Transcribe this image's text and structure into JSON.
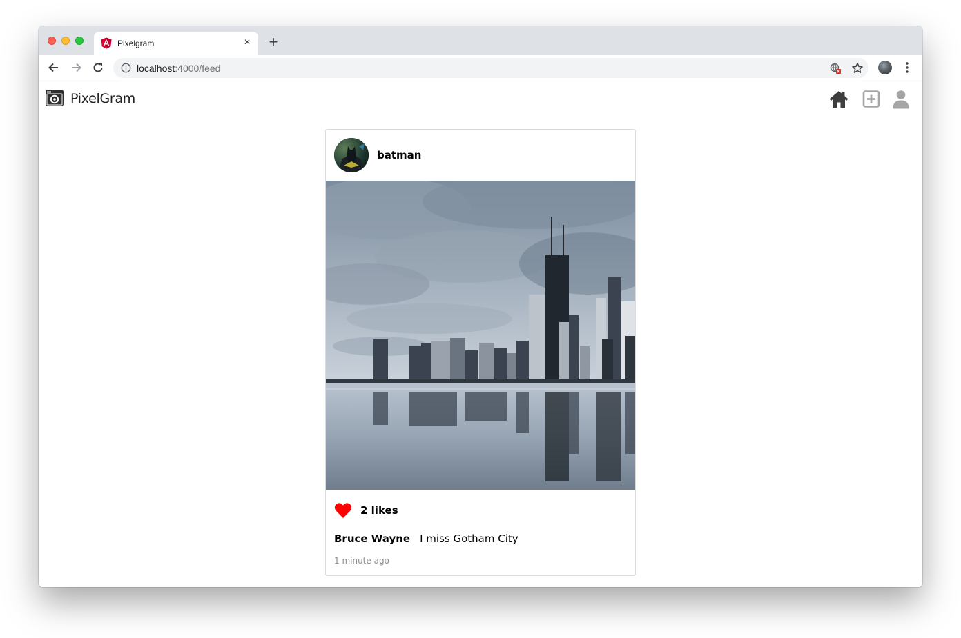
{
  "browser": {
    "tab_title": "Pixelgram",
    "tab_close": "×",
    "new_tab": "+",
    "url_host": "localhost",
    "url_rest": ":4000/feed"
  },
  "app": {
    "brand": "PixelGram",
    "nav_icons": [
      "home-icon",
      "add-post-icon",
      "profile-icon"
    ]
  },
  "post": {
    "username": "batman",
    "likes_text": "2 likes",
    "caption_user": "Bruce Wayne",
    "caption_text": "I miss Gotham City",
    "timestamp": "1 minute ago",
    "liked": true
  },
  "colors": {
    "heart": "#ff0000",
    "tabstrip": "#dee1e6",
    "icon_dark": "#3d3d3d",
    "icon_gray": "#a5a5a5"
  }
}
